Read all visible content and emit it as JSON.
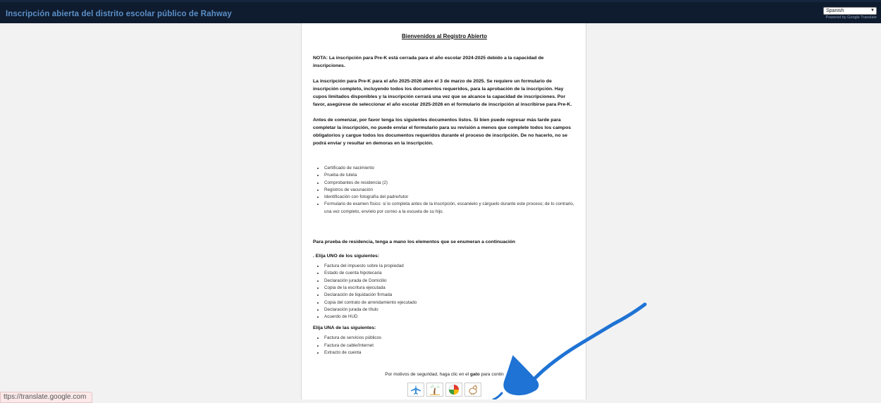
{
  "header": {
    "site_title": "Inscripción abierta del distrito escolar público de Rahway",
    "language_selected": "Spanish",
    "powered_by": "Powered by Google Translate"
  },
  "main": {
    "welcome_title": "Bienvenidos al Registro Abierto",
    "note": "NOTA: La inscripción para Pre-K está cerrada para el año escolar 2024-2025 debido a la capacidad de inscripciones.",
    "prek_info": "La inscripción para Pre-K para el año 2025-2026 abre el 3 de marzo de 2025. Se requiere un formulario de inscripción completo, incluyendo todos los documentos requeridos, para la aprobación de la inscripción. Hay cupos limitados disponibles y la inscripción cerrará una vez que se alcance la capacidad de inscripciones. Por favor, asegúrese de seleccionar el año escolar 2025-2026 en el formulario de inscripción al inscribirse para Pre-K.",
    "before_start": "Antes de comenzar, por favor tenga los siguientes documentos listos. Si bien puede regresar más tarde para completar la inscripción, no puede enviar el formulario para su revisión a menos que complete todos los campos obligatorios y cargue todos los documentos requeridos durante el proceso de inscripción. De no hacerlo, no se podrá enviar y resultar en demoras en la inscripción.",
    "documents": [
      "Certificado de nacimiento",
      "Prueba de tutela",
      "Comprobantes de residencia (2)",
      "Registros de vacunación",
      "Identificación con fotografía del padre/tutor",
      "Formulario de examen físico: si lo completa antes de la inscripción, escanéelo y cárguelo durante este proceso; de lo contrario, una vez completo, envíelo por correo a la escuela de su hijo."
    ],
    "residency_heading": "Para prueba de residencia, tenga a mano los elementos que se enumeran a continuación",
    "choose_one_heading": ". Elija UNO de los siguientes:",
    "choose_one_items": [
      "Factura del impuesto sobre la propiedad",
      "Estado de cuenta hipotecaria",
      "Declaración jurada de Domicilio",
      "Copia de la escritura ejecutada",
      "Declaración de liquidación firmada",
      "Copia del contrato de arrendamiento ejecutado",
      "Declaración jurada de título",
      "Acuerdo de HUD"
    ],
    "choose_una_heading": "Elija UNA de las siguientes:",
    "choose_una_items": [
      "Factura de servicios públicos",
      "Factura de cable/Internet",
      "Extracto de cuenta"
    ],
    "security_prefix": "Por motivos de seguridad, haga clic en el ",
    "security_word": "gato",
    "security_suffix": " para contin",
    "captcha_icons": [
      "airplane-icon",
      "palm-tree-icon",
      "beach-ball-icon",
      "chicken-icon"
    ]
  },
  "status_bar": {
    "url": "ttps://translate.google.com"
  },
  "colors": {
    "header_bg": "#0f1b2e",
    "title_color": "#5b8fc7",
    "annotation_stroke": "#1f73d4"
  }
}
